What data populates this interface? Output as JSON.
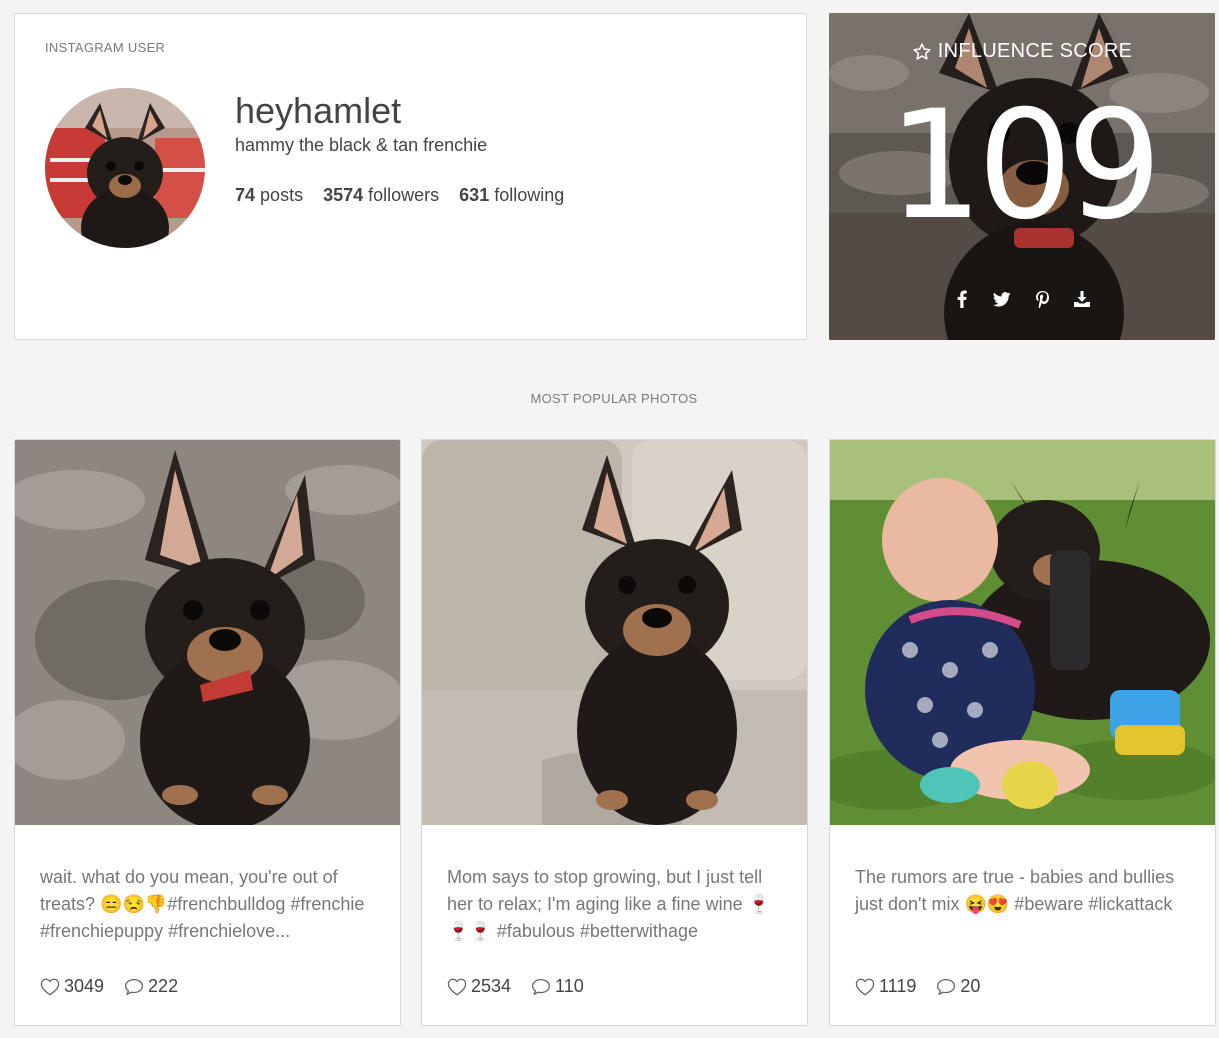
{
  "profile": {
    "eyebrow": "INSTAGRAM USER",
    "username": "heyhamlet",
    "bio": "hammy the black & tan frenchie",
    "posts_count": "74",
    "posts_label": "posts",
    "followers_count": "3574",
    "followers_label": "followers",
    "following_count": "631",
    "following_label": "following"
  },
  "influence": {
    "title": "INFLUENCE SCORE",
    "score": "109",
    "share_icons": [
      "facebook-icon",
      "twitter-icon",
      "pinterest-icon",
      "download-icon"
    ]
  },
  "section": {
    "title": "MOST POPULAR PHOTOS"
  },
  "photos": [
    {
      "caption": "wait. what do you mean, you're out of treats? 😑😒👎#frenchbulldog #frenchie #frenchiepuppy #frenchielove...",
      "likes": "3049",
      "comments": "222"
    },
    {
      "caption": "Mom says to stop growing, but I just tell her to relax; I'm aging like a fine wine 🍷🍷🍷 #fabulous #betterwithage",
      "likes": "2534",
      "comments": "110"
    },
    {
      "caption": "The rumors are true - babies and bullies just don't mix 😝😍 #beware #lickattack",
      "likes": "1119",
      "comments": "20"
    }
  ],
  "colors": {
    "page_bg": "#f4f4f5",
    "card_border": "#d6d6dc",
    "text_dark": "#444444",
    "text_muted": "#777777"
  }
}
